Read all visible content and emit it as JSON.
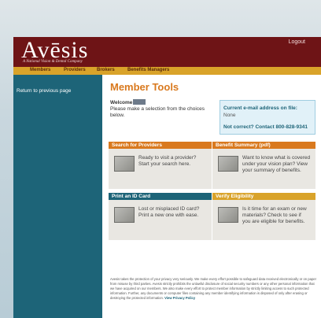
{
  "header": {
    "logo": "Avēsis",
    "tagline": "A National Vision & Dental Company",
    "logout_label": "Logout"
  },
  "nav": {
    "items": [
      "Members",
      "Providers",
      "Brokers",
      "Benefits Managers"
    ]
  },
  "sidebar": {
    "return_label": "Return to previous page"
  },
  "main": {
    "title": "Member Tools",
    "welcome_label": "Welcome",
    "instructions": "Please make a selection from the choices below.",
    "email_box": {
      "label": "Current e-mail address on file:",
      "value": "None",
      "correction": "Not correct? Contact 800-828-9341"
    },
    "cards": [
      {
        "title": "Search for Providers",
        "text": "Ready to visit a provider? Start your search here.",
        "color": "#d9791e",
        "icon": "magnifier-icon"
      },
      {
        "title": "Benefit Summary (pdf)",
        "text": "Want to know what is covered under your vision plan? View your summary of benefits.",
        "color": "#d9791e",
        "icon": "document-icon"
      },
      {
        "title": "Print an ID Card",
        "text": "Lost or misplaced ID card? Print a new one with ease.",
        "color": "#1d6478",
        "icon": "id-card-icon"
      },
      {
        "title": "Verify Eligibility",
        "text": "Is it time for an exam or new materials? Check to see if you are eligible for benefits.",
        "color": "#d9a32a",
        "icon": "checklist-icon"
      }
    ],
    "footer": {
      "text": "Avesis takes the protection of your privacy very seriously. We make every effort possible to safeguard data received electronically or on paper from misuse by third parties. Avesis strictly prohibits the unlawful disclosure of social security numbers or any other personal information that we have acquired on our members. We also make every effort to protect member information by strictly limiting access to such protected information. Further, any documents or computer files containing any member identifying information is disposed of only after erasing or destroying the protected information.",
      "link": "View Privacy Policy"
    }
  },
  "colors": {
    "brand_red": "#6e1416",
    "nav_gold": "#d9a32a",
    "sidebar_teal": "#1d6478",
    "accent_orange": "#d9791e"
  }
}
